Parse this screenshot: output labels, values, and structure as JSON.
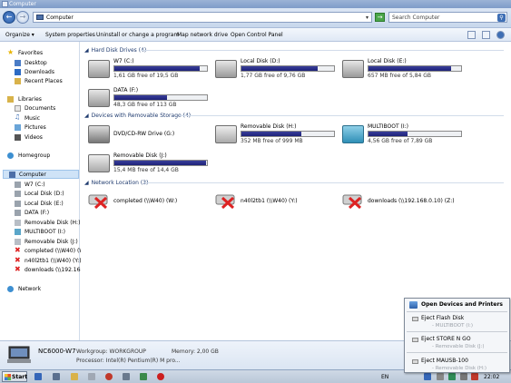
{
  "window": {
    "title": "Computer"
  },
  "address": {
    "path": "Computer",
    "search_placeholder": "Search Computer"
  },
  "toolbar": {
    "organize": "Organize",
    "system_properties": "System properties",
    "uninstall": "Uninstall or change a program",
    "map_drive": "Map network drive",
    "control_panel": "Open Control Panel"
  },
  "sidebar": {
    "favorites": "Favorites",
    "desktop": "Desktop",
    "downloads": "Downloads",
    "recent": "Recent Places",
    "libraries": "Libraries",
    "documents": "Documents",
    "music": "Music",
    "pictures": "Pictures",
    "videos": "Videos",
    "homegroup": "Homegroup",
    "computer": "Computer",
    "drives": [
      "W7 (C:)",
      "Local Disk (D:)",
      "Local Disk (E:)",
      "DATA (F:)",
      "Removable Disk (H:)",
      "MULTIBOOT (I:)",
      "Removable Disk (J:)",
      "completed (\\\\W40) (W",
      "n40l2tb1 (\\\\W40) (Y:)",
      "downloads (\\\\192.168"
    ],
    "network": "Network"
  },
  "sections": {
    "hdd": "Hard Disk Drives (4)",
    "removable": "Devices with Removable Storage (4)",
    "network": "Network Location (3)"
  },
  "hdd": [
    {
      "name": "W7 (C:)",
      "free": "1,61 GB free of 19,5 GB",
      "used_fraction": 0.92
    },
    {
      "name": "Local Disk (D:)",
      "free": "1,77 GB free of 9,76 GB",
      "used_fraction": 0.82
    },
    {
      "name": "Local Disk (E:)",
      "free": "657 MB free of 5,84 GB",
      "used_fraction": 0.89
    },
    {
      "name": "DATA (F:)",
      "free": "48,3 GB free of 113 GB",
      "used_fraction": 0.57
    }
  ],
  "removable": [
    {
      "name": "DVD/CD-RW Drive (G:)"
    },
    {
      "name": "Removable Disk (H:)",
      "free": "352 MB free of 999 MB",
      "used_fraction": 0.65
    },
    {
      "name": "MULTIBOOT (I:)",
      "free": "4,56 GB free of 7,89 GB",
      "used_fraction": 0.42
    },
    {
      "name": "Removable Disk (J:)",
      "free": "15,4 MB free of 14,4 GB",
      "used_fraction": 0.99
    }
  ],
  "network": [
    {
      "name": "completed (\\\\W40) (W:)"
    },
    {
      "name": "n40l2tb1 (\\\\W40) (Y:)"
    },
    {
      "name": "downloads (\\\\192.168.0.10) (Z:)"
    }
  ],
  "details": {
    "computer_name": "NC6000-W7",
    "workgroup": "Workgroup: WORKGROUP",
    "memory": "Memory: 2,00 GB",
    "processor": "Processor: Intel(R) Pentium(R) M pro..."
  },
  "popup": {
    "header": "Open Devices and Printers",
    "items": [
      {
        "label": "Eject Flash Disk",
        "sub": "- MULTIBOOT (I:)"
      },
      {
        "label": "Eject STORE N GO",
        "sub": "- Removable Disk (J:)"
      },
      {
        "label": "Eject MAUSB-100",
        "sub": "- Removable Disk (H:)"
      }
    ]
  },
  "taskbar": {
    "start": "Start",
    "lang": "EN",
    "clock": "22:02"
  }
}
